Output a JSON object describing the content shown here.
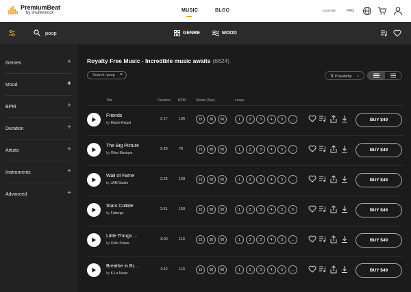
{
  "brand": {
    "name": "PremiumBeat",
    "sub": "by shutterstock",
    "accent": "#f5a623"
  },
  "topnav": {
    "music": "MUSIC",
    "blog": "BLOG",
    "license": "License",
    "faq": "FAQ"
  },
  "search": {
    "value": "poop"
  },
  "filters": {
    "genre": "GENRE",
    "mood": "MOOD"
  },
  "sidebar": {
    "items": [
      {
        "label": "Genres"
      },
      {
        "label": "Mood"
      },
      {
        "label": "BPM"
      },
      {
        "label": "Duration"
      },
      {
        "label": "Artists"
      },
      {
        "label": "Instruments"
      },
      {
        "label": "Advanced"
      }
    ]
  },
  "main": {
    "title": "Royalty Free Music - Incredible music awaits",
    "count": "(6624)",
    "search_chip": "Search: poop",
    "sort_label": "Popularity"
  },
  "columns": {
    "title": "Title",
    "duration": "Duration",
    "bpm": "BPM",
    "shorts": "Shorts (Sec)",
    "loops": "Loops"
  },
  "tracks": [
    {
      "title": "Friends",
      "by": "by",
      "artist": "Martin Riopel",
      "duration": "2:17",
      "bpm": "136",
      "shorts": [
        "15",
        "30",
        "60"
      ],
      "loops": [
        "1",
        "2",
        "3",
        "4",
        "5",
        "..."
      ],
      "buy": "BUY $49"
    },
    {
      "title": "The Big Picture",
      "by": "by",
      "artist": "Olive Musique",
      "duration": "2:20",
      "bpm": "70",
      "shorts": [
        "15",
        "30",
        "60"
      ],
      "loops": [
        "1",
        "2",
        "3",
        "4",
        "5",
        "..."
      ],
      "buy": "BUY $49"
    },
    {
      "title": "Wall of Fame",
      "by": "by",
      "artist": "JAM Studio",
      "duration": "2:25",
      "bpm": "128",
      "shorts": [
        "15",
        "30",
        "60"
      ],
      "loops": [
        "1",
        "2",
        "3",
        "4",
        "5",
        "..."
      ],
      "buy": "BUY $49"
    },
    {
      "title": "Stars Collide",
      "by": "by",
      "artist": "Faberge",
      "duration": "2:51",
      "bpm": "150",
      "shorts": [
        "15",
        "30",
        "60"
      ],
      "loops": [
        "1",
        "2",
        "3",
        "4",
        "5",
        "6"
      ],
      "buy": "BUY $49"
    },
    {
      "title": "Little Things ...",
      "by": "by",
      "artist": "Colin Fraser",
      "duration": "3:00",
      "bpm": "110",
      "shorts": [
        "15",
        "30",
        "60"
      ],
      "loops": [
        "1",
        "2",
        "3",
        "4",
        "5",
        "..."
      ],
      "buy": "BUY $49"
    },
    {
      "title": "Breathe in Br...",
      "by": "by",
      "artist": "K-La Music",
      "duration": "1:42",
      "bpm": "110",
      "shorts": [
        "15",
        "30",
        "60"
      ],
      "loops": [
        "1",
        "2",
        "3",
        "4",
        "5",
        "..."
      ],
      "buy": "BUY $49"
    }
  ]
}
